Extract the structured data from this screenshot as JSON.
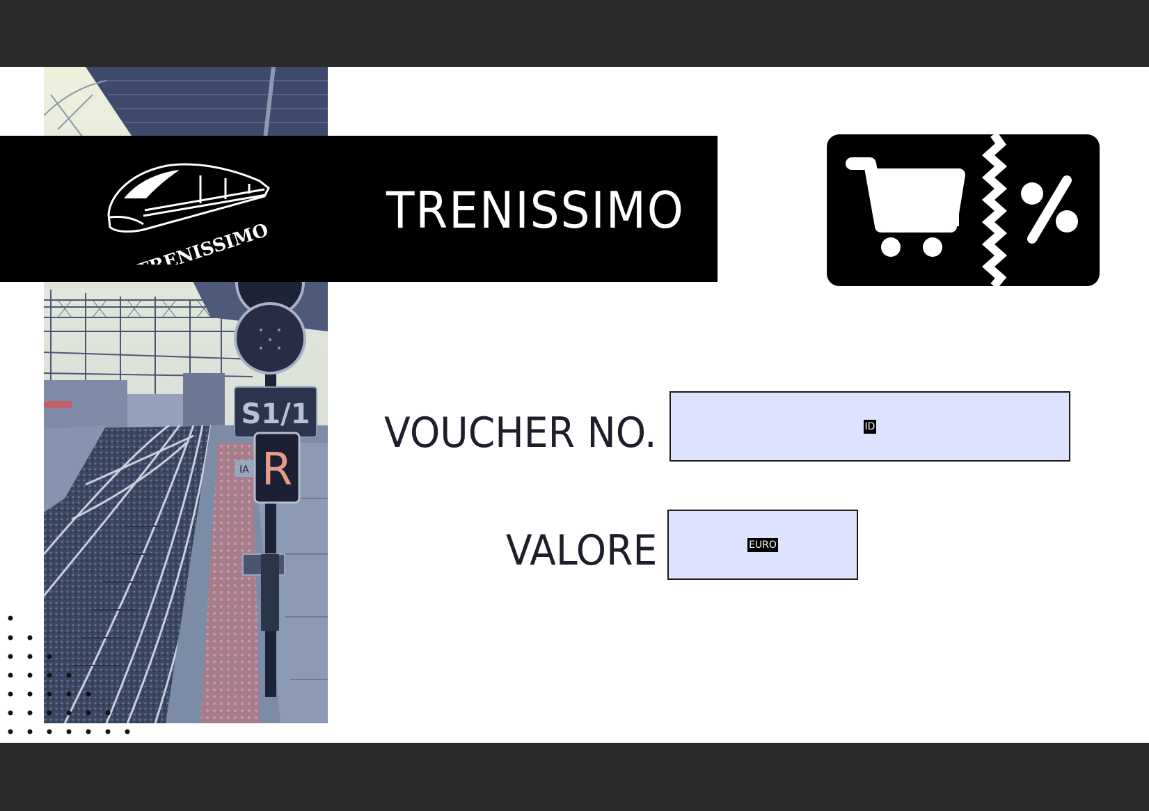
{
  "brand": {
    "name": "TRENISSIMO",
    "logo_text": "TRENISSIMO"
  },
  "icons": {
    "logo": "train-logo-icon",
    "coupon": "shopping-cart-discount-coupon-icon"
  },
  "form": {
    "voucher_label": "VOUCHER NO.",
    "voucher_field_tag": "ID",
    "value_label": "VALORE",
    "value_field_tag": "EURO"
  },
  "colors": {
    "banner": "#000000",
    "field_fill": "#dde3fd",
    "viewer_background": "#2a2a2a",
    "page": "#ffffff"
  }
}
